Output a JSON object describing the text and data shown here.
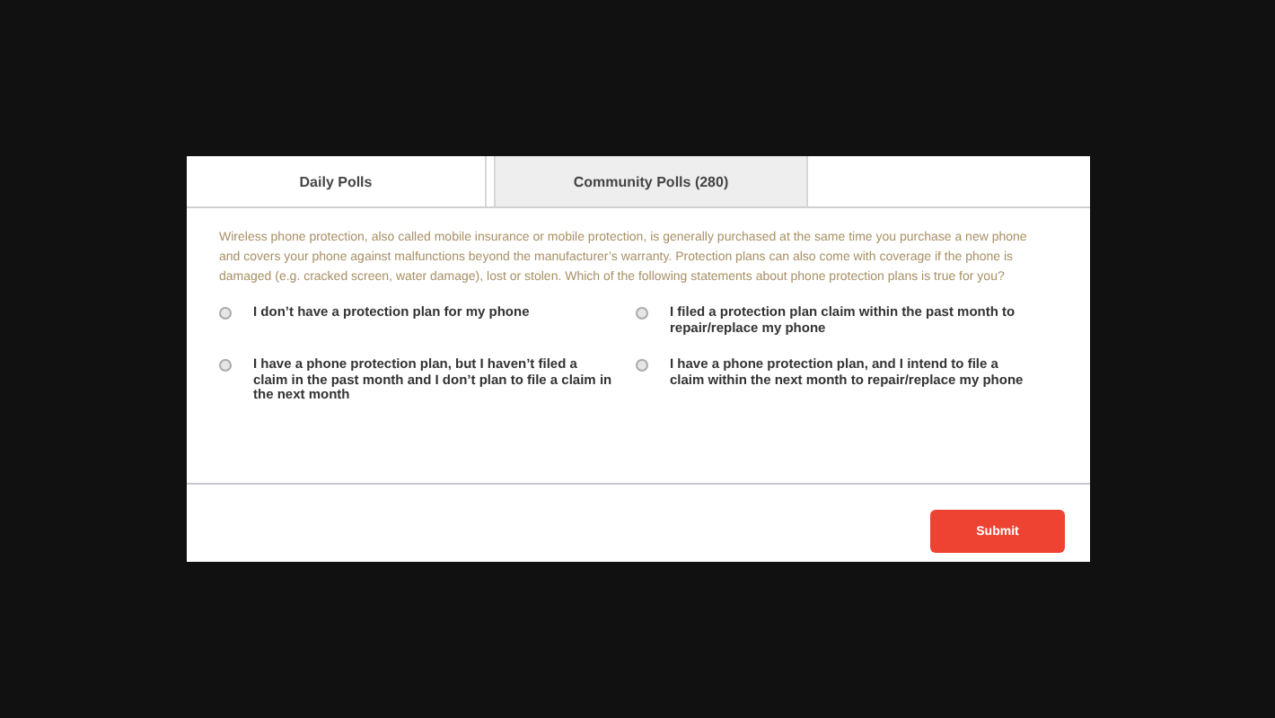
{
  "tabs": [
    {
      "label": "Daily Polls",
      "selected": true
    },
    {
      "label": "Community Polls (280)",
      "selected": false
    }
  ],
  "question": "Wireless phone protection, also called mobile insurance or mobile protection, is generally purchased at the same time you purchase a new phone and covers your phone against malfunctions beyond the manufacturer’s warranty. Protection plans can also come with coverage if the phone is damaged (e.g. cracked screen, water damage), lost or stolen. Which of the following statements about phone protection plans is true for you?",
  "options": [
    {
      "label": "I don’t have a protection plan for my phone",
      "selected": false
    },
    {
      "label": "I filed a protection plan claim within the past month to repair/replace my phone",
      "selected": false
    },
    {
      "label": "I have a phone protection plan, but I haven’t filed a claim in the past month and I don’t plan to file a claim in the next month",
      "selected": false
    },
    {
      "label": "I have a phone protection plan, and I intend to file a claim within the next month to repair/replace my phone",
      "selected": false
    }
  ],
  "submit": "Submit"
}
